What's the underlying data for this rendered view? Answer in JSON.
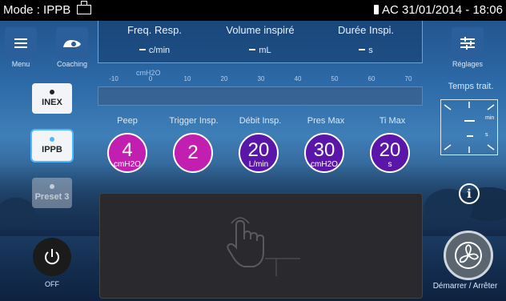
{
  "status_bar": {
    "mode": "Mode : IPPB",
    "ac": "AC",
    "datetime": "31/01/2014 - 18:06"
  },
  "header_params": [
    {
      "label": "Freq. Resp.",
      "value": "c/min"
    },
    {
      "label": "Volume inspiré",
      "value": "mL"
    },
    {
      "label": "Durée Inspi.",
      "value": "s"
    }
  ],
  "left_buttons": {
    "menu": "Menu",
    "coaching": "Coaching"
  },
  "right_buttons": {
    "settings": "Réglages",
    "treatment_time": "Temps trait.",
    "timer_min": "min",
    "timer_s": "s"
  },
  "ruler": {
    "unit": "cmH2O",
    "ticks": [
      "-10",
      "0",
      "10",
      "20",
      "30",
      "40",
      "50",
      "60",
      "70"
    ]
  },
  "modes": [
    {
      "label": "INEX",
      "state": "normal"
    },
    {
      "label": "IPPB",
      "state": "active"
    },
    {
      "label": "Preset 3",
      "state": "disabled"
    }
  ],
  "controls": [
    {
      "label": "Peep",
      "value": "4",
      "unit": "cmH2O",
      "color": "#c21fb0"
    },
    {
      "label": "Trigger Insp.",
      "value": "2",
      "unit": "",
      "color": "#c21fb0"
    },
    {
      "label": "Débit Insp.",
      "value": "20",
      "unit": "L/min",
      "color": "#5a16a8"
    },
    {
      "label": "Pres Max",
      "value": "30",
      "unit": "cmH2O",
      "color": "#5a16a8"
    },
    {
      "label": "Ti Max",
      "value": "20",
      "unit": "s",
      "color": "#5a16a8"
    }
  ],
  "power": {
    "label": "OFF"
  },
  "start_stop": {
    "label": "Démarrer / Arrêter"
  }
}
